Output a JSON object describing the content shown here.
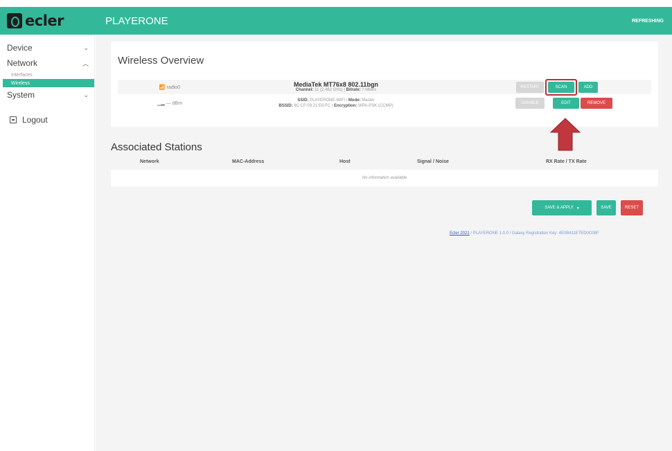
{
  "header": {
    "brand": "ecler",
    "title": "PLAYERONE",
    "status": "REFRESHING",
    "accent_color": "#33b99a"
  },
  "sidebar": {
    "items": [
      {
        "label": "Device",
        "chevron": "⌄",
        "icon": "chevron-down-icon"
      },
      {
        "label": "Network",
        "chevron": "︿",
        "icon": "chevron-up-icon"
      },
      {
        "label": "System",
        "chevron": "⌄",
        "icon": "chevron-down-icon"
      }
    ],
    "network_sub": [
      {
        "label": "Interfaces",
        "active": false
      },
      {
        "label": "Wireless",
        "active": true
      }
    ],
    "logout": "Logout"
  },
  "wireless_overview": {
    "title": "Wireless Overview",
    "device": {
      "name": "radio0",
      "model": "MediaTek MT76x8 802.11bgn",
      "channel_label": "Channel:",
      "channel_value": "11 (2.462 GHz)",
      "bitrate_label": "Bitrate:",
      "bitrate_value": "? Mbit/s",
      "buttons": {
        "restart": "RESTART",
        "scan": "SCAN",
        "add": "ADD"
      }
    },
    "network": {
      "signal": "— dBm",
      "ssid_label": "SSID:",
      "ssid_value": "PLAYERONE-WIFI",
      "mode_label": "Mode:",
      "mode_value": "Master",
      "bssid_label": "BSSID:",
      "bssid_value": "8C:CF:09:21:E6:FC",
      "enc_label": "Encryption:",
      "enc_value": "WPA-PSK (CCMP)",
      "buttons": {
        "disable": "DISABLE",
        "edit": "EDIT",
        "remove": "REMOVE"
      }
    }
  },
  "stations": {
    "title": "Associated Stations",
    "columns": [
      "Network",
      "MAC-Address",
      "Host",
      "Signal / Noise",
      "RX Rate / TX Rate"
    ],
    "empty": "No information available"
  },
  "actions": {
    "save_apply": "SAVE & APPLY",
    "save": "SAVE",
    "reset": "RESET"
  },
  "footer": {
    "link": "Ecler 2021",
    "text": " / PLAYERONE 1.0.0 / Galaxy Registration Key: 4E0B411E7ED0C08F"
  }
}
